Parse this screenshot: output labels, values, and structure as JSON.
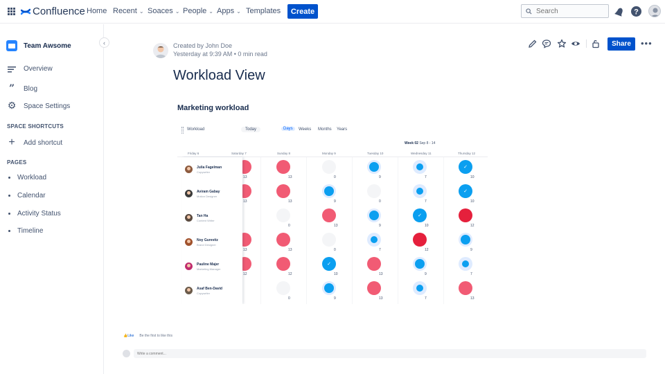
{
  "header": {
    "app_name": "Confluence",
    "nav": [
      {
        "label": "Home",
        "dropdown": false
      },
      {
        "label": "Recent",
        "dropdown": true
      },
      {
        "label": "Soaces",
        "dropdown": true
      },
      {
        "label": "People",
        "dropdown": true
      },
      {
        "label": "Apps",
        "dropdown": true
      },
      {
        "label": "Templates",
        "dropdown": false
      }
    ],
    "create_label": "Create",
    "search_placeholder": "Search",
    "icons": [
      "app-switcher-icon",
      "notifications-icon",
      "help-icon",
      "profile-avatar"
    ]
  },
  "sidebar": {
    "space_name": "Team Awsome",
    "links": [
      {
        "label": "Overview",
        "icon": "overview-icon"
      },
      {
        "label": "Blog",
        "icon": "blog-quote-icon"
      },
      {
        "label": "Space Settings",
        "icon": "gear-icon"
      }
    ],
    "shortcuts_heading": "SPACE SHORTCUTS",
    "add_shortcut": "Add shortcut",
    "pages_heading": "PAGES",
    "pages": [
      "Workload",
      "Calendar",
      "Activity Status",
      "Timeline"
    ]
  },
  "page": {
    "byline_author": "Created by John Doe",
    "byline_meta": "Yesterday at 9:39 AM  •  0 min read",
    "title": "Workload View",
    "share_label": "Share",
    "section_heading": "Marketing workload"
  },
  "workload": {
    "toolbar_title": "Workload",
    "today_label": "Today",
    "ranges": [
      "Days",
      "Weeks",
      "Months",
      "Years"
    ],
    "active_range": "Days",
    "week_label": "Week 02",
    "week_dates": "Sep 8 - 14",
    "days": [
      "Friday 6",
      "Saturday 7",
      "Sunday 8",
      "Monday 9",
      "Tuesday 10",
      "Wednesday 11",
      "Thursday 12"
    ],
    "colors": {
      "over": "#f15b74",
      "over_dark": "#e5203c",
      "ok": "#0b9ff0",
      "halo": "#deebff",
      "empty": "#f4f5f7"
    },
    "people": [
      {
        "name": "Julia Fagelman",
        "role": "Copywriter",
        "avatar_color": "#8d5b3f"
      },
      {
        "name": "Aviram Gabay",
        "role": "Motion Designer",
        "avatar_color": "#3b3b3b"
      },
      {
        "name": "Tan Ha",
        "role": "Content Writer",
        "avatar_color": "#5a4a3f"
      },
      {
        "name": "Noy Gurevitz",
        "role": "Brand Designer",
        "avatar_color": "#a0522d"
      },
      {
        "name": "Pauline Majer",
        "role": "Marketing Manager",
        "avatar_color": "#c02c6e"
      },
      {
        "name": "Asaf Ben-David",
        "role": "Copywriter",
        "avatar_color": "#6b5b4b"
      }
    ],
    "cells": [
      [
        {
          "s": "over"
        },
        {
          "s": "over",
          "n": "13"
        },
        {
          "s": "empty",
          "n": "0"
        },
        {
          "s": "ok",
          "n": "9",
          "size": "m"
        },
        {
          "s": "ok",
          "n": "7",
          "size": "s"
        },
        {
          "s": "check",
          "n": "10"
        }
      ],
      [
        {
          "s": "over"
        },
        {
          "s": "over",
          "n": "13"
        },
        {
          "s": "ok",
          "n": "9",
          "size": "m"
        },
        {
          "s": "empty",
          "n": "0"
        },
        {
          "s": "ok",
          "n": "7",
          "size": "s"
        },
        {
          "s": "check",
          "n": "10"
        }
      ],
      [
        {
          "s": "none"
        },
        {
          "s": "empty",
          "n": "0"
        },
        {
          "s": "over",
          "n": "13"
        },
        {
          "s": "ok",
          "n": "9",
          "size": "m"
        },
        {
          "s": "check",
          "n": "10"
        },
        {
          "s": "over_dark",
          "n": "12"
        }
      ],
      [
        {
          "s": "over"
        },
        {
          "s": "over",
          "n": "13"
        },
        {
          "s": "empty",
          "n": "0"
        },
        {
          "s": "ok",
          "n": "7",
          "size": "s"
        },
        {
          "s": "over_dark",
          "n": "12"
        },
        {
          "s": "ok",
          "n": "9",
          "size": "m"
        }
      ],
      [
        {
          "s": "over"
        },
        {
          "s": "over",
          "n": "12"
        },
        {
          "s": "check",
          "n": "10"
        },
        {
          "s": "over",
          "n": "13"
        },
        {
          "s": "ok",
          "n": "9",
          "size": "m"
        },
        {
          "s": "ok",
          "n": "7",
          "size": "s"
        }
      ],
      [
        {
          "s": "none"
        },
        {
          "s": "empty",
          "n": "0"
        },
        {
          "s": "ok",
          "n": "9",
          "size": "m"
        },
        {
          "s": "over",
          "n": "13"
        },
        {
          "s": "ok",
          "n": "7",
          "size": "s"
        },
        {
          "s": "over",
          "n": "13"
        }
      ]
    ],
    "extra_counts": [
      "13",
      "13",
      "",
      "13",
      "12",
      ""
    ]
  },
  "footer": {
    "like_label": "Like",
    "like_prompt": "Be the first to like this",
    "comment_placeholder": "Write a comment..."
  }
}
